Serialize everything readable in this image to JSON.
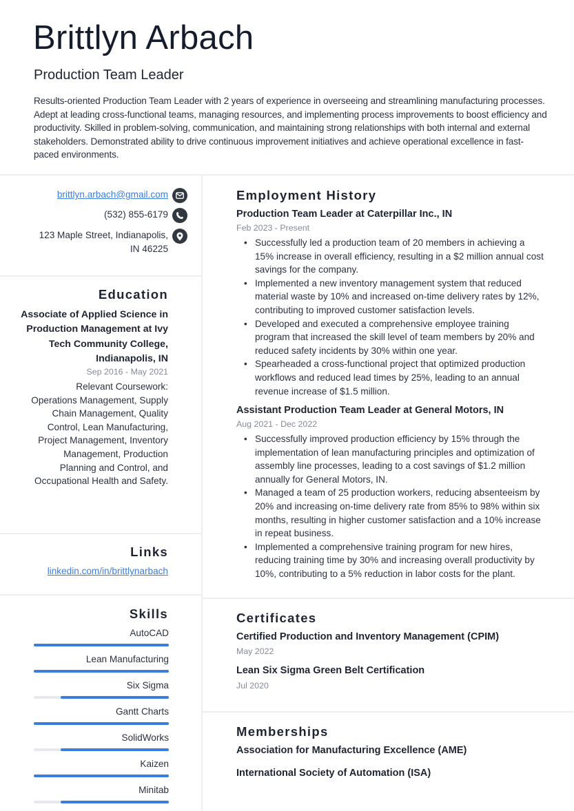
{
  "header": {
    "name": "Brittlyn Arbach",
    "title": "Production Team Leader",
    "summary": "Results-oriented Production Team Leader with 2 years of experience in overseeing and streamlining manufacturing processes. Adept at leading cross-functional teams, managing resources, and implementing process improvements to boost efficiency and productivity. Skilled in problem-solving, communication, and maintaining strong relationships with both internal and external stakeholders. Demonstrated ability to drive continuous improvement initiatives and achieve operational excellence in fast-paced environments."
  },
  "contact": {
    "email": "brittlyn.arbach@gmail.com",
    "email_icon": "envelope-icon",
    "phone": "(532) 855-6179",
    "phone_icon": "phone-icon",
    "address_line1": "123 Maple Street, Indianapolis,",
    "address_line2": "IN 46225",
    "address_icon": "map-pin-icon"
  },
  "education": {
    "heading": "Education",
    "degree": "Associate of Applied Science in Production Management at Ivy Tech Community College, Indianapolis, IN",
    "dates": "Sep 2016 - May 2021",
    "description": "Relevant Coursework: Operations Management, Supply Chain Management, Quality Control, Lean Manufacturing, Project Management, Inventory Management, Production Planning and Control, and Occupational Health and Safety."
  },
  "links": {
    "heading": "Links",
    "items": [
      {
        "label": "linkedin.com/in/brittlynarbach"
      }
    ]
  },
  "skills": {
    "heading": "Skills",
    "accent_color": "#3b7ddd",
    "items": [
      {
        "name": "AutoCAD",
        "level_percent": 100
      },
      {
        "name": "Lean Manufacturing",
        "level_percent": 100
      },
      {
        "name": "Six Sigma",
        "level_percent": 80
      },
      {
        "name": "Gantt Charts",
        "level_percent": 100
      },
      {
        "name": "SolidWorks",
        "level_percent": 80
      },
      {
        "name": "Kaizen",
        "level_percent": 100
      },
      {
        "name": "Minitab",
        "level_percent": 80
      }
    ]
  },
  "employment": {
    "heading": "Employment History",
    "jobs": [
      {
        "title": "Production Team Leader at Caterpillar Inc., IN",
        "dates": "Feb 2023 - Present",
        "bullets": [
          "Successfully led a production team of 20 members in achieving a 15% increase in overall efficiency, resulting in a $2 million annual cost savings for the company.",
          "Implemented a new inventory management system that reduced material waste by 10% and increased on-time delivery rates by 12%, contributing to improved customer satisfaction levels.",
          "Developed and executed a comprehensive employee training program that increased the skill level of team members by 20% and reduced safety incidents by 30% within one year.",
          "Spearheaded a cross-functional project that optimized production workflows and reduced lead times by 25%, leading to an annual revenue increase of $1.5 million."
        ]
      },
      {
        "title": "Assistant Production Team Leader at General Motors, IN",
        "dates": "Aug 2021 - Dec 2022",
        "bullets": [
          "Successfully improved production efficiency by 15% through the implementation of lean manufacturing principles and optimization of assembly line processes, leading to a cost savings of $1.2 million annually for General Motors, IN.",
          "Managed a team of 25 production workers, reducing absenteeism by 20% and increasing on-time delivery rate from 85% to 98% within six months, resulting in higher customer satisfaction and a 10% increase in repeat business.",
          "Implemented a comprehensive training program for new hires, reducing training time by 30% and increasing overall productivity by 10%, contributing to a 5% reduction in labor costs for the plant."
        ]
      }
    ]
  },
  "certificates": {
    "heading": "Certificates",
    "items": [
      {
        "title": "Certified Production and Inventory Management (CPIM)",
        "date": "May 2022"
      },
      {
        "title": "Lean Six Sigma Green Belt Certification",
        "date": "Jul 2020"
      }
    ]
  },
  "memberships": {
    "heading": "Memberships",
    "items": [
      {
        "title": "Association for Manufacturing Excellence (AME)"
      },
      {
        "title": "International Society of Automation (ISA)"
      }
    ]
  }
}
